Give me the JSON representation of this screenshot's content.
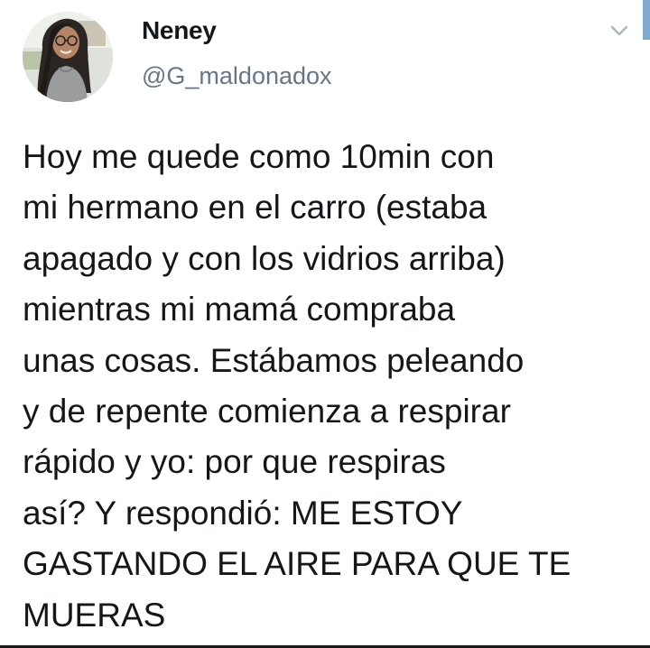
{
  "tweet": {
    "author": {
      "display_name": "Neney",
      "handle": "@G_maldonadox",
      "avatar_icon": "profile-photo-avatar"
    },
    "menu_icon": "chevron-down-icon",
    "text_lines": [
      "Hoy me quede como 10min con",
      "mi hermano en el carro (estaba",
      "apagado y con los vidrios arriba)",
      "mientras mi mamá compraba",
      "unas cosas. Estábamos peleando",
      "y de repente comienza a respirar",
      "rápido y yo: por que respiras",
      "así? Y respondió: ME ESTOY",
      "GASTANDO EL AIRE PARA QUE TE",
      "MUERAS"
    ]
  },
  "colors": {
    "name": "#14171a",
    "handle": "#657786",
    "text": "#14171a",
    "chevron": "#aab8c2",
    "accent_edge": "#7fa9cf"
  }
}
